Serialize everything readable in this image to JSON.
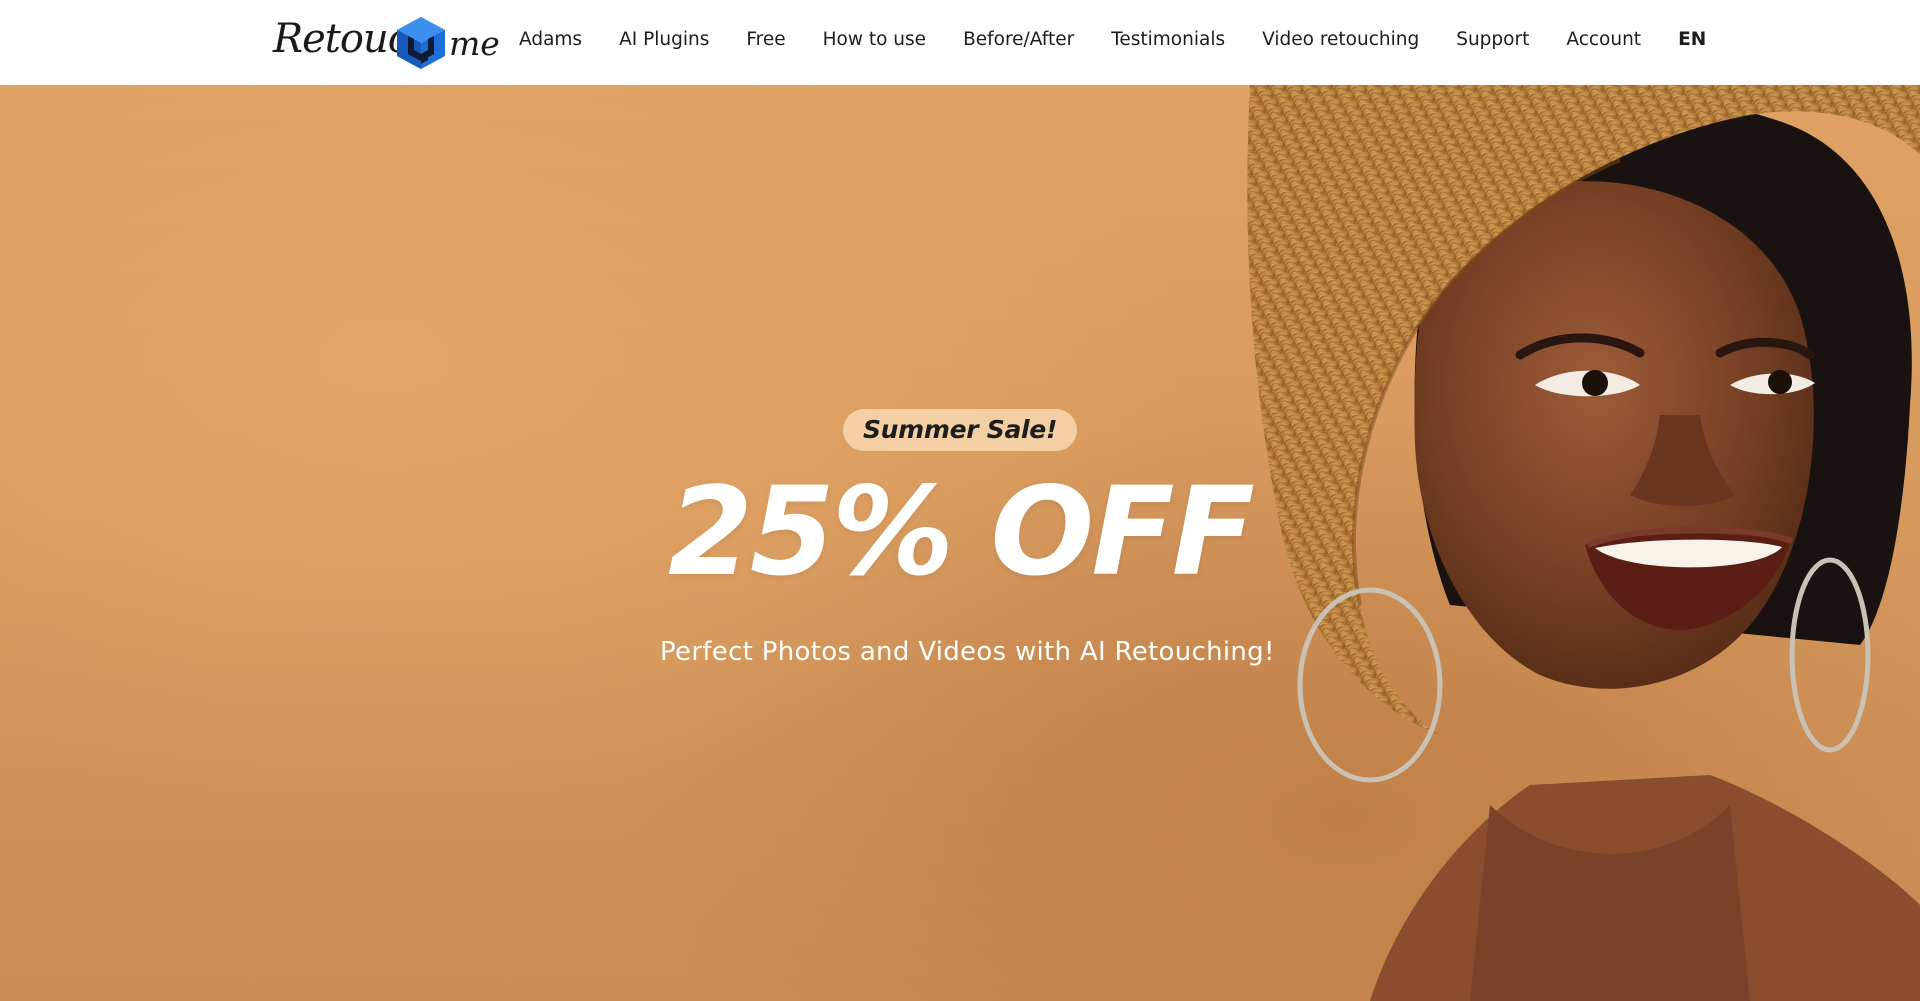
{
  "header": {
    "logo": {
      "text_left": "Retouch",
      "text_right": "me",
      "mark_icon": "cube-logo-icon"
    },
    "nav": {
      "items": [
        {
          "label": "Adams"
        },
        {
          "label": "AI Plugins"
        },
        {
          "label": "Free"
        },
        {
          "label": "How to use"
        },
        {
          "label": "Before/After"
        },
        {
          "label": "Testimonials"
        },
        {
          "label": "Video retouching"
        },
        {
          "label": "Support"
        },
        {
          "label": "Account"
        }
      ],
      "language": "EN"
    }
  },
  "hero": {
    "badge": "Summer Sale!",
    "headline": "25% OFF",
    "tagline": "Perfect Photos and Videos with AI Retouching!",
    "image": "smiling-woman-straw-hat-photo"
  },
  "colors": {
    "hero_background": "#d99c5e",
    "badge_background": "#f3cfa3",
    "logo_blue": "#1e6fd9",
    "nav_text": "#1d1d1d"
  }
}
